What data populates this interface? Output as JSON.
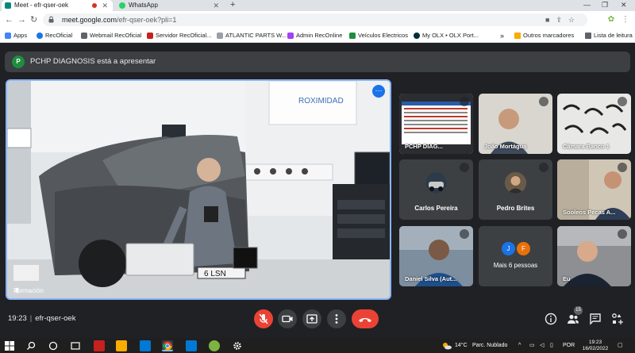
{
  "browser": {
    "tabs": [
      {
        "title": "Meet - efr-qser-oek",
        "icon": "meet-icon",
        "recording": true
      },
      {
        "title": "WhatsApp",
        "icon": "whatsapp-icon"
      }
    ],
    "url_domain": "meet.google.com",
    "url_path": "/efr-qser-oek?pli=1",
    "bookmarks": [
      {
        "label": "Apps",
        "icon": "apps-grid-icon",
        "color": "#4285f4"
      },
      {
        "label": "RecOficial",
        "icon": "globe-icon",
        "color": "#1a73e8"
      },
      {
        "label": "Webmail RecOficial",
        "icon": "mail-icon",
        "color": "#5f6368"
      },
      {
        "label": "Servidor RecOficial...",
        "icon": "server-icon",
        "color": "#c5221f"
      },
      {
        "label": "ATLANTIC PARTS W...",
        "icon": "document-icon",
        "color": "#9aa0a6"
      },
      {
        "label": "Admin RecOnline",
        "icon": "admin-icon",
        "color": "#a142f4"
      },
      {
        "label": "Veículos Electricos",
        "icon": "car-icon",
        "color": "#1e8e3e"
      },
      {
        "label": "My OLX • OLX Port...",
        "icon": "olx-icon",
        "color": "#002f34"
      }
    ],
    "bookmarks_more": "»",
    "other_bookmarks": "Outros marcadores",
    "reading_list": "Lista de leitura"
  },
  "meet": {
    "presenting_avatar": "P",
    "presenting_text": "PCHP DIAGNOSIS está a apresentar",
    "main_label": "Formación",
    "main_wall_sign": "ROXIMIDAD",
    "main_plate": "6 LSN",
    "participants": [
      {
        "name": "PCHP DIAG...",
        "type": "screen"
      },
      {
        "name": "João Mortágua",
        "type": "video"
      },
      {
        "name": "Câmara Banco 1",
        "type": "video"
      },
      {
        "name": "Carlos Pereira",
        "type": "avatar"
      },
      {
        "name": "Pedro Brites",
        "type": "avatar"
      },
      {
        "name": "Sooleos Pecas A...",
        "type": "video"
      },
      {
        "name": "Daniel Silva (Aut...",
        "type": "video"
      },
      {
        "name": "Mais 6 pessoas",
        "type": "more",
        "initials": [
          "J",
          "F"
        ]
      },
      {
        "name": "Eu",
        "type": "video"
      }
    ],
    "time": "19:23",
    "meeting_code": "efr-qser-oek",
    "people_count": "15"
  },
  "taskbar": {
    "weather_temp": "14°C",
    "weather_text": "Parc. Nublado",
    "language": "POR",
    "time": "19:23",
    "date": "16/02/2022"
  },
  "colors": {
    "accent": "#8ab4f8",
    "danger": "#ea4335",
    "meet_bg": "#202124",
    "tile_bg": "#3c4043"
  }
}
